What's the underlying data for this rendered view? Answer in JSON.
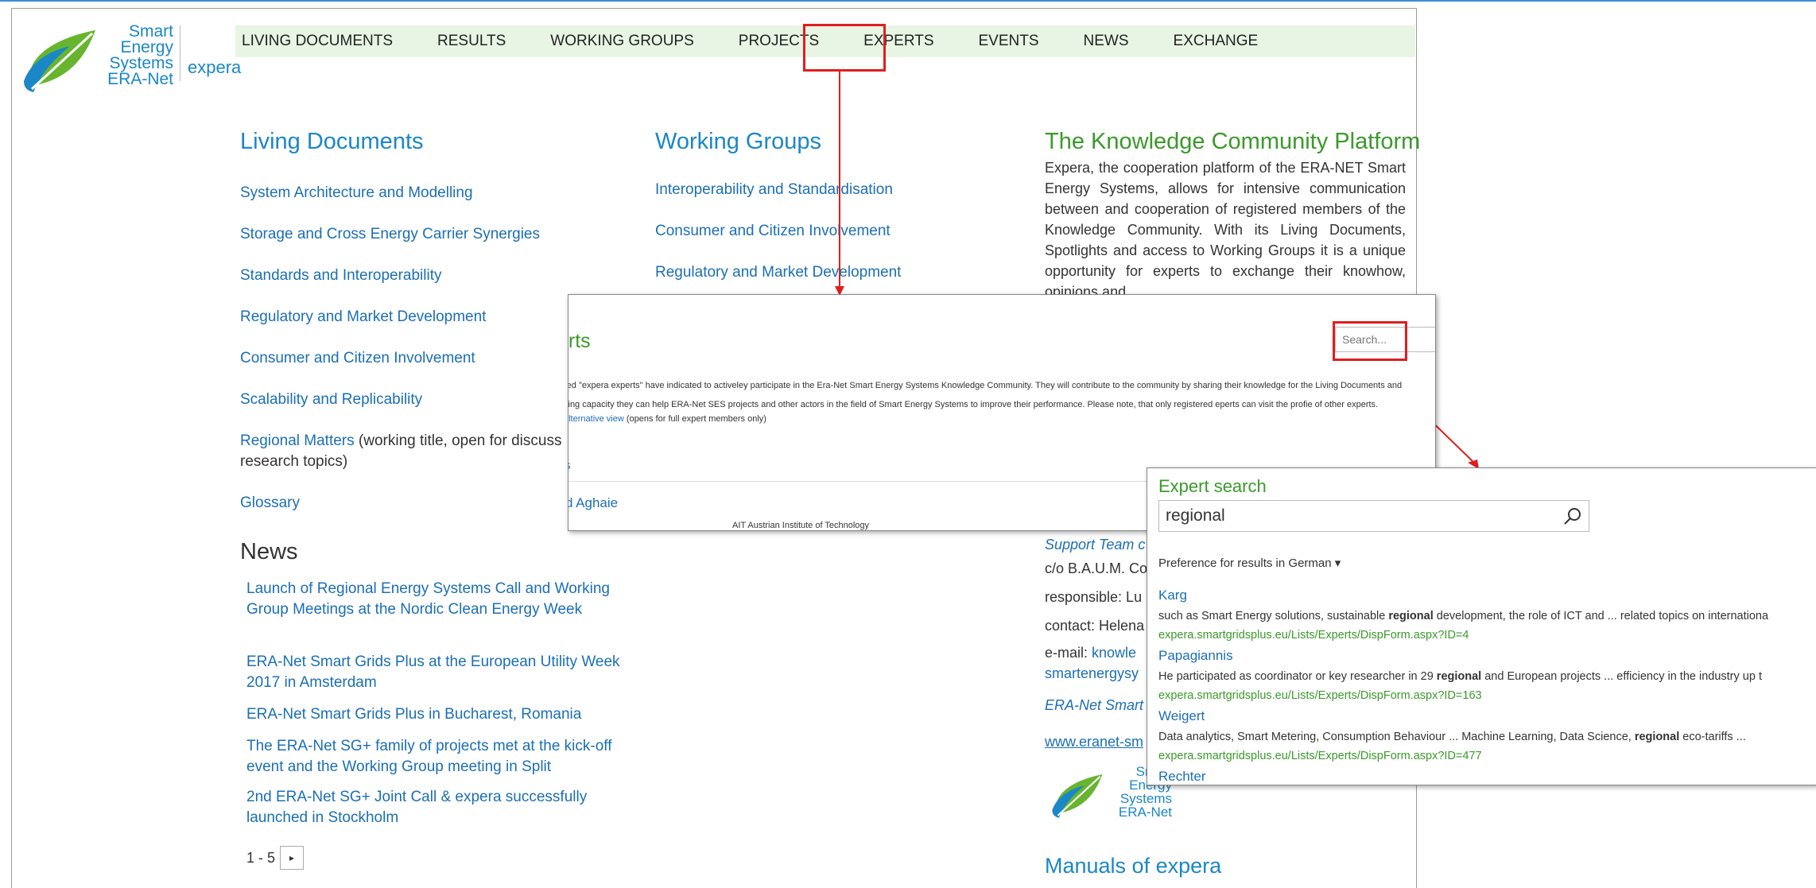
{
  "logo": {
    "brand_lines": [
      "Smart",
      "Energy",
      "Systems",
      "ERA-Net"
    ],
    "product": "expera"
  },
  "nav": {
    "items": [
      "LIVING DOCUMENTS",
      "RESULTS",
      "WORKING GROUPS",
      "PROJECTS",
      "EXPERTS",
      "EVENTS",
      "NEWS",
      "EXCHANGE"
    ],
    "highlighted": "EXPERTS"
  },
  "living_documents": {
    "title": "Living Documents",
    "items": [
      "System Architecture and Modelling",
      "Storage and Cross Energy Carrier Synergies",
      "Standards and Interoperability",
      "Regulatory and Market Development",
      "Consumer and Citizen Involvement",
      "Scalability and Replicability"
    ],
    "regional_link": "Regional Matters",
    "regional_note": " (working title, open for discuss",
    "regional_note2": "research topics)",
    "glossary": "Glossary"
  },
  "working_groups": {
    "title": "Working Groups",
    "items": [
      "Interoperability and Standardisation",
      "Consumer and Citizen Involvement",
      "Regulatory and Market Development"
    ]
  },
  "platform": {
    "title": "The Knowledge Community Platform",
    "text": "Expera, the cooperation platform of the ERA-NET Smart Energy Systems, allows for intensive communication between and cooperation of registered members of the Knowledge Community. With its Living Documents, Spotlights and access to Working Groups it is a unique opportunity for experts to exchange their knowhow, opinions and"
  },
  "news": {
    "title": "News",
    "items": [
      "Launch of Regional Energy Systems Call and Working Group Meetings at the Nordic Clean Energy Week",
      "ERA-Net Smart Grids Plus at the European Utility Week 2017 in Amsterdam",
      "ERA-Net Smart Grids Plus in Bucharest, Romania",
      "The ERA-Net SG+ family of projects met at the kick-off event and the Working Group meeting in Split",
      "2nd ERA-Net SG+ Joint Call & expera successfully launched in Stockholm"
    ],
    "pager": "1 - 5"
  },
  "support": {
    "team": "Support Team c",
    "line1": "c/o B.A.U.M. Co",
    "line2": "responsible: Lu",
    "line3_prefix": "contact: Helena",
    "line4_prefix": "e-mail: ",
    "line4_link": "knowle",
    "line5": "smartenergysy",
    "era": "ERA-Net Smart",
    "url": "www.eranet-sm"
  },
  "manuals": {
    "title": "Manuals of expera"
  },
  "experts_panel": {
    "title": "erts",
    "search_placeholder": "Search...",
    "desc1": "red \"expera experts\" have indicated to activeley participate in the Era-Net Smart Energy Systems Knowledge Community. They will contribute to the community by sharing their knowledge for the Living Documents and",
    "desc2": "king capacity they can help ERA-Net SES projects and other actors in the field of Smart Energy Systems to improve their performance. Please note, that only registered eperts can visit the profie of other experts.",
    "alt_link": "alternative view",
    "alt_note": " (opens for full expert members only)",
    "subtitle": "rts",
    "expert_name": "mid Aghaie",
    "expert_org": "AIT Austrian Institute of Technology"
  },
  "expert_search": {
    "title": "Expert search",
    "query": "regional",
    "preference": "Preference for results in German ▾",
    "results": [
      {
        "name": "Karg",
        "snip_pre": "such as Smart Energy solutions, sustainable ",
        "snip_bold": "regional",
        "snip_post": " development, the role of ICT and ... related topics on internationa",
        "url": "expera.smartgridsplus.eu/Lists/Experts/DispForm.aspx?ID=4"
      },
      {
        "name": "Papagiannis",
        "snip_pre": "He participated as coordinator or key researcher in 29 ",
        "snip_bold": "regional",
        "snip_post": " and European projects ... efficiency in the industry up t",
        "url": "expera.smartgridsplus.eu/Lists/Experts/DispForm.aspx?ID=163"
      },
      {
        "name": "Weigert",
        "snip_pre": "Data analytics, Smart Metering, Consumption Behaviour ... Machine Learning, Data Science, ",
        "snip_bold": "regional",
        "snip_post": " eco-tariffs ...",
        "url": "expera.smartgridsplus.eu/Lists/Experts/DispForm.aspx?ID=477"
      },
      {
        "name": "Rechter",
        "snip_pre": "",
        "snip_bold": "",
        "snip_post": "",
        "url": ""
      }
    ]
  },
  "colors": {
    "accent_blue": "#1b6fb5",
    "accent_green": "#3a9a2a",
    "highlight_red": "#e01e1e",
    "nav_bg": "#e9f5e4"
  }
}
